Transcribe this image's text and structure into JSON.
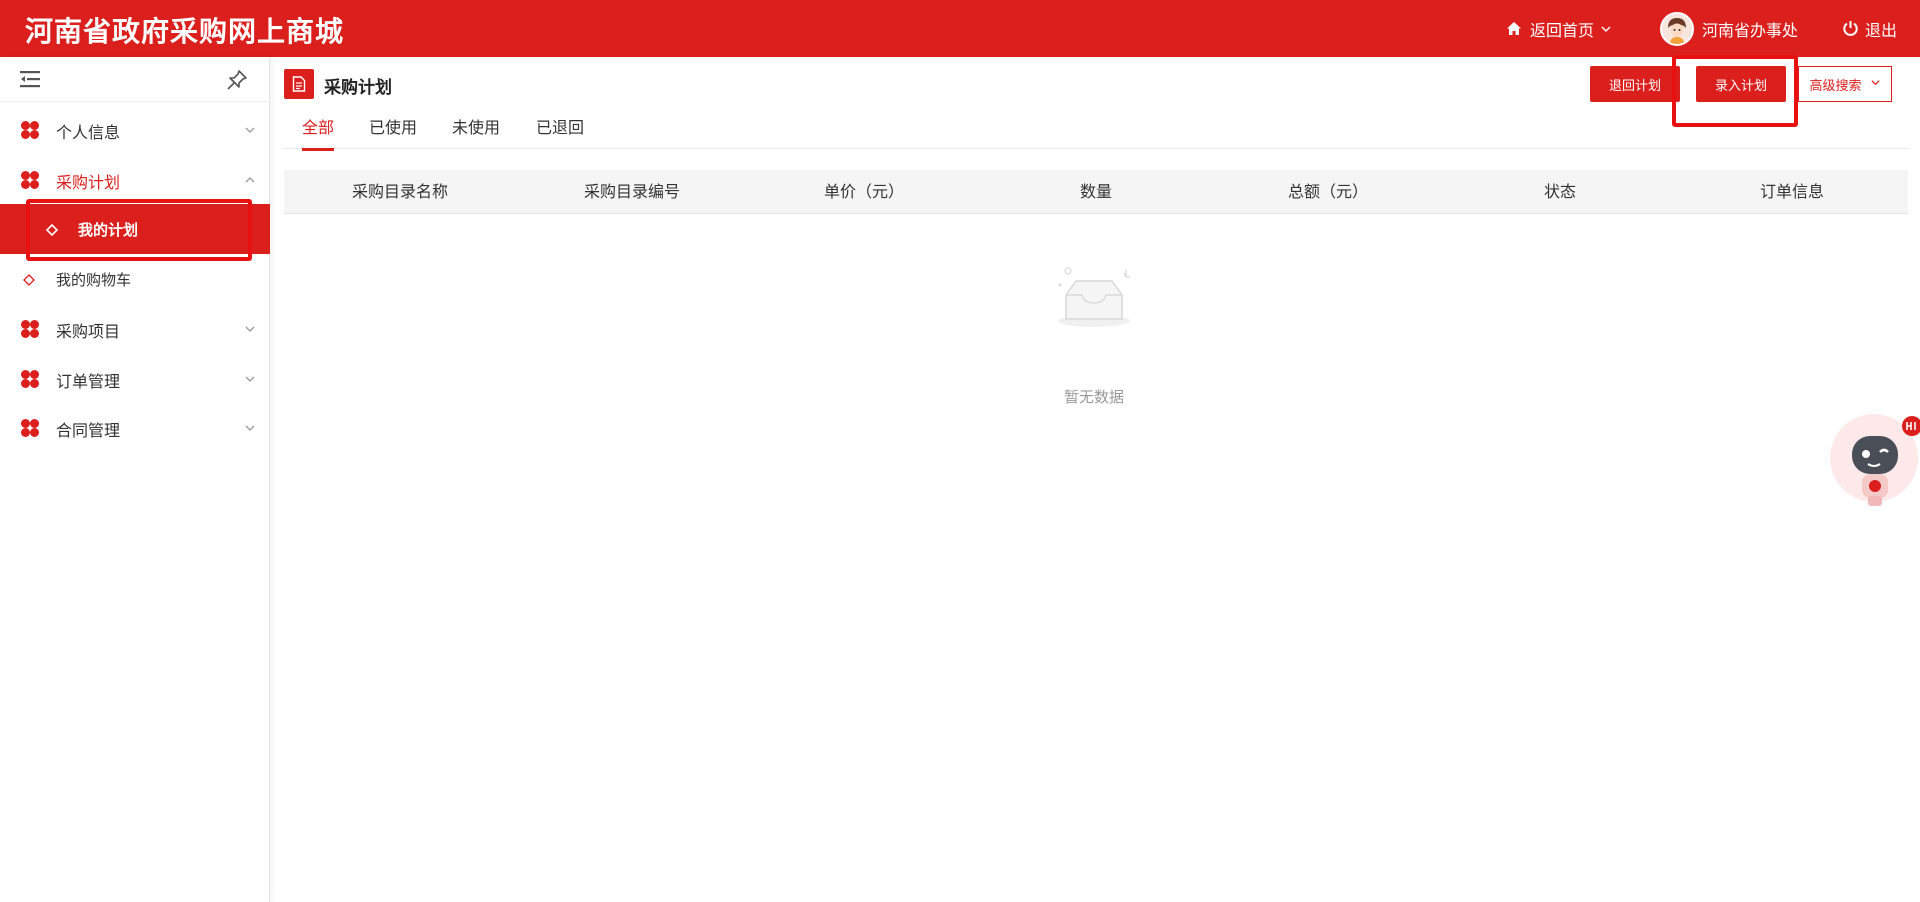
{
  "header": {
    "brand": "河南省政府采购网上商城",
    "home_label": "返回首页",
    "user_name": "河南省办事处",
    "logout_label": "退出"
  },
  "sidebar": {
    "items": [
      {
        "label": "个人信息",
        "icon": "flower-icon",
        "expanded": false
      },
      {
        "label": "采购计划",
        "icon": "flower-icon",
        "expanded": true,
        "children": [
          {
            "label": "我的计划",
            "active": true
          },
          {
            "label": "我的购物车",
            "active": false
          }
        ]
      },
      {
        "label": "采购项目",
        "icon": "flower-icon",
        "expanded": false
      },
      {
        "label": "订单管理",
        "icon": "flower-icon",
        "expanded": false
      },
      {
        "label": "合同管理",
        "icon": "flower-icon",
        "expanded": false
      }
    ]
  },
  "main": {
    "title": "采购计划",
    "buttons": {
      "return_plan": "退回计划",
      "enter_plan": "录入计划",
      "advanced_search": "高级搜索"
    },
    "tabs": [
      {
        "label": "全部",
        "active": true
      },
      {
        "label": "已使用",
        "active": false
      },
      {
        "label": "未使用",
        "active": false
      },
      {
        "label": "已退回",
        "active": false
      }
    ],
    "table": {
      "columns": [
        "采购目录名称",
        "采购目录编号",
        "单价（元）",
        "数量",
        "总额（元）",
        "状态",
        "订单信息"
      ],
      "rows": [],
      "empty_text": "暂无数据"
    }
  },
  "colors": {
    "brand_red": "#db1f1c",
    "highlight_red": "#e8110f"
  }
}
